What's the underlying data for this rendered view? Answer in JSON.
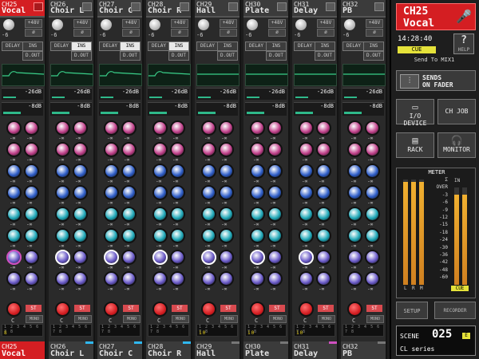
{
  "channels": [
    {
      "num": "CH25",
      "name": "Vocal",
      "color": "#d41e22",
      "selected": true,
      "gain": "-6",
      "ins_on": false
    },
    {
      "num": "CH26",
      "name": "Choir L",
      "color": "#30b8f0",
      "selected": false,
      "gain": "-6",
      "ins_on": true
    },
    {
      "num": "CH27",
      "name": "Choir C",
      "color": "#30b8f0",
      "selected": false,
      "gain": "-6",
      "ins_on": true
    },
    {
      "num": "CH28",
      "name": "Choir R",
      "color": "#30b8f0",
      "selected": false,
      "gain": "-6",
      "ins_on": true
    },
    {
      "num": "CH29",
      "name": "Hall",
      "color": "#777777",
      "selected": false,
      "gain": "-6",
      "ins_on": false
    },
    {
      "num": "CH30",
      "name": "Plate",
      "color": "#777777",
      "selected": false,
      "gain": "-6",
      "ins_on": false
    },
    {
      "num": "CH31",
      "name": "Delay",
      "color": "#d050c0",
      "selected": false,
      "gain": "-6",
      "ins_on": false
    },
    {
      "num": "CH32",
      "name": "PB",
      "color": "#777777",
      "selected": false,
      "gain": "-6",
      "ins_on": false
    }
  ],
  "strip_labels": {
    "phantom": "+48V",
    "phase": "ø",
    "delay": "DELAY",
    "ins": "INS",
    "dout": "D.OUT",
    "dyn1": "-26dB",
    "dyn2": "-8dB",
    "knob_value": "-∞",
    "pan": "C",
    "st": "ST",
    "mono": "MONO",
    "dca": "1 2 3 4 5 6 7 8"
  },
  "dca_values": [
    "8",
    "",
    "",
    "",
    "10",
    "10",
    "10",
    ""
  ],
  "knob_colors": [
    "#c0408a",
    "#c0408a",
    "#2f5ec8",
    "#2f5ec8",
    "#20a8b8",
    "#20a8b8",
    "#6a5ac8",
    "#6a5ac8"
  ],
  "right": {
    "selected_num": "CH25",
    "selected_name": "Vocal",
    "time": "14:28:40",
    "cue": "CUE",
    "help": "HELP",
    "send_to": "Send To MIX1",
    "sends_on_fader": "SENDS\nON FADER",
    "io_device": "I/O DEVICE",
    "ch_job": "CH JOB",
    "rack": "RACK",
    "monitor": "MONITOR",
    "meter_title": "METER",
    "meter_scale": [
      "Σ",
      "OVER",
      "-3",
      "-6",
      "-9",
      "-12",
      "-15",
      "-18",
      "-24",
      "-30",
      "-36",
      "-42",
      "-48",
      "-60"
    ],
    "meter_in": "IN",
    "meter_L": "L",
    "meter_R": "R",
    "meter_M": "M",
    "meter_cue": "CUE",
    "setup": "SETUP",
    "recorder": "RECORDER",
    "scene_label": "SCENE",
    "scene_num": "025",
    "scene_name": "CL series",
    "scene_edit": "E"
  },
  "meter_levels": {
    "L": 0.98,
    "R": 0.98,
    "M": 0.98,
    "cue": 0.93
  }
}
